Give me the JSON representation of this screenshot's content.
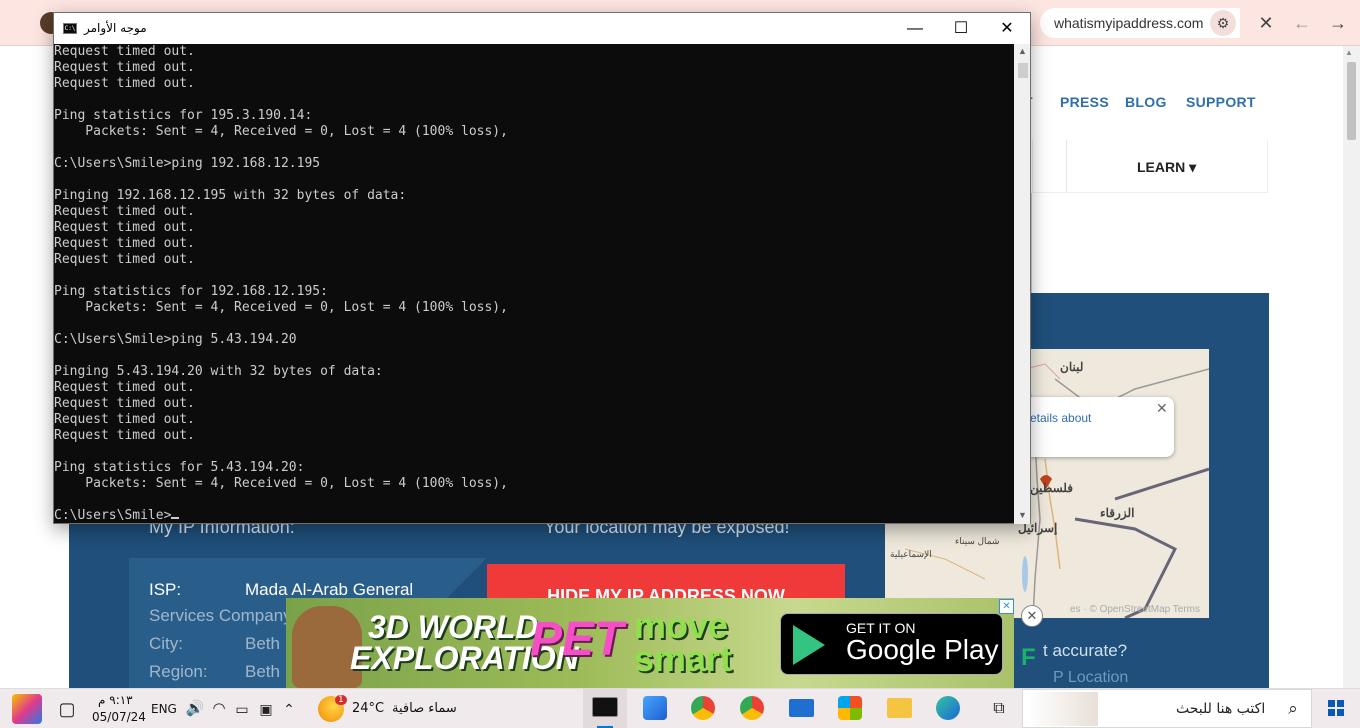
{
  "browser": {
    "url": "whatismyipaddress.com",
    "tune_icon": "tune-icon",
    "close_icon": "close-icon",
    "back_icon": "back-arrow-icon",
    "forward_icon": "forward-arrow-icon"
  },
  "site": {
    "nav": [
      "T",
      "PRESS",
      "BLOG",
      "SUPPORT"
    ],
    "learn_label": "LEARN ▾",
    "hero_left_title": "My IP Information:",
    "hero_right_title": "Your location may be exposed!",
    "isp_label": "ISP:",
    "isp_value": "Mada Al-Arab General",
    "isp_value_cont": "Services Company",
    "city_label": "City:",
    "city_value": "Beth",
    "region_label": "Region:",
    "region_value": "Beth",
    "hide_button": "HIDE MY IP ADDRESS NOW",
    "map_popup_text": "etails about",
    "map_labels": {
      "lebanon": "لبنان",
      "palestine": "فلسطين",
      "israel": "إسرائيل",
      "zarqa": "الزرقاء",
      "sinai": "شمال سيناء",
      "ismailia": "الإسماعيلية"
    },
    "map_attr": "es · © OpenStreetMap Terms",
    "accurate_text": "t accurate?",
    "ip_location_link": "P Location"
  },
  "ad": {
    "line1": "3D WORLD",
    "line2": "EXPLORATION",
    "pet": "PET",
    "move": "move",
    "smart": "smart",
    "gp_get": "GET IT ON",
    "gp_name": "Google Play",
    "close_symbol": "✕",
    "info_symbol": "✕"
  },
  "cmd": {
    "title": "موجه الأوامر",
    "icon_text": "C:\\",
    "lines": [
      "Request timed out.",
      "Request timed out.",
      "Request timed out.",
      "",
      "Ping statistics for 195.3.190.14:",
      "    Packets: Sent = 4, Received = 0, Lost = 4 (100% loss),",
      "",
      "C:\\Users\\Smile>ping 192.168.12.195",
      "",
      "Pinging 192.168.12.195 with 32 bytes of data:",
      "Request timed out.",
      "Request timed out.",
      "Request timed out.",
      "Request timed out.",
      "",
      "Ping statistics for 192.168.12.195:",
      "    Packets: Sent = 4, Received = 0, Lost = 4 (100% loss),",
      "",
      "C:\\Users\\Smile>ping 5.43.194.20",
      "",
      "Pinging 5.43.194.20 with 32 bytes of data:",
      "Request timed out.",
      "Request timed out.",
      "Request timed out.",
      "Request timed out.",
      "",
      "Ping statistics for 5.43.194.20:",
      "    Packets: Sent = 4, Received = 0, Lost = 4 (100% loss),",
      ""
    ],
    "prompt": "C:\\Users\\Smile>",
    "minimize_symbol": "—",
    "maximize_symbol": "☐",
    "close_symbol": "✕"
  },
  "taskbar": {
    "search_placeholder": "اكتب هنا للبحث",
    "time": "٩:١٣ م",
    "date": "05/07/24",
    "language": "ENG",
    "weather_temp": "24°C",
    "weather_text": "سماء صافية",
    "weather_badge": "1"
  },
  "colors": {
    "browser_bar": "#fde5e1",
    "hero_blue": "#1f4f7a",
    "hide_red": "#f03a3a",
    "cmd_bg": "#0c0c0c",
    "link_blue": "#2f6fb0"
  }
}
